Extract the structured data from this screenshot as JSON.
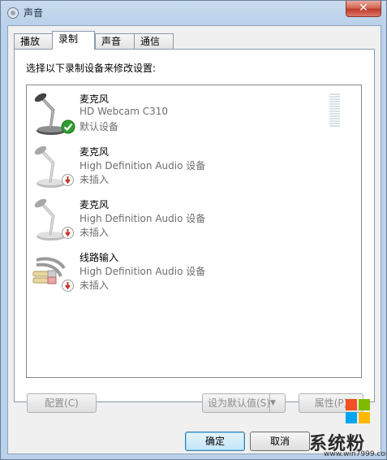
{
  "window": {
    "title": "声音",
    "close_glyph": "✕"
  },
  "tabs": [
    {
      "label": "播放"
    },
    {
      "label": "录制",
      "active": true
    },
    {
      "label": "声音"
    },
    {
      "label": "通信"
    }
  ],
  "panel": {
    "instruction": "选择以下录制设备来修改设置:"
  },
  "devices": [
    {
      "name": "麦克风",
      "description": "HD Webcam C310",
      "status": "默认设备",
      "icon": "microphone-icon",
      "badge": "default-check-icon"
    },
    {
      "name": "麦克风",
      "description": "High Definition Audio 设备",
      "status": "未插入",
      "icon": "microphone-icon",
      "badge": "unplugged-icon"
    },
    {
      "name": "麦克风",
      "description": "High Definition Audio 设备",
      "status": "未插入",
      "icon": "microphone-icon",
      "badge": "unplugged-icon"
    },
    {
      "name": "线路输入",
      "description": "High Definition Audio 设备",
      "status": "未插入",
      "icon": "line-in-cable-icon",
      "badge": "unplugged-icon"
    }
  ],
  "level_meter": {
    "level": 0,
    "segments": 14
  },
  "buttons": {
    "configure": "配置(C)",
    "set_default": "设为默认值(S)",
    "properties": "属性(P)",
    "ok": "确定",
    "cancel": "取消"
  },
  "watermark": {
    "text": "系统粉",
    "url": "www.win7999.com"
  },
  "colors": {
    "check_green": "#2f9e2f",
    "unplug_red": "#c0392b",
    "title_bar": "#b9d1ea"
  }
}
